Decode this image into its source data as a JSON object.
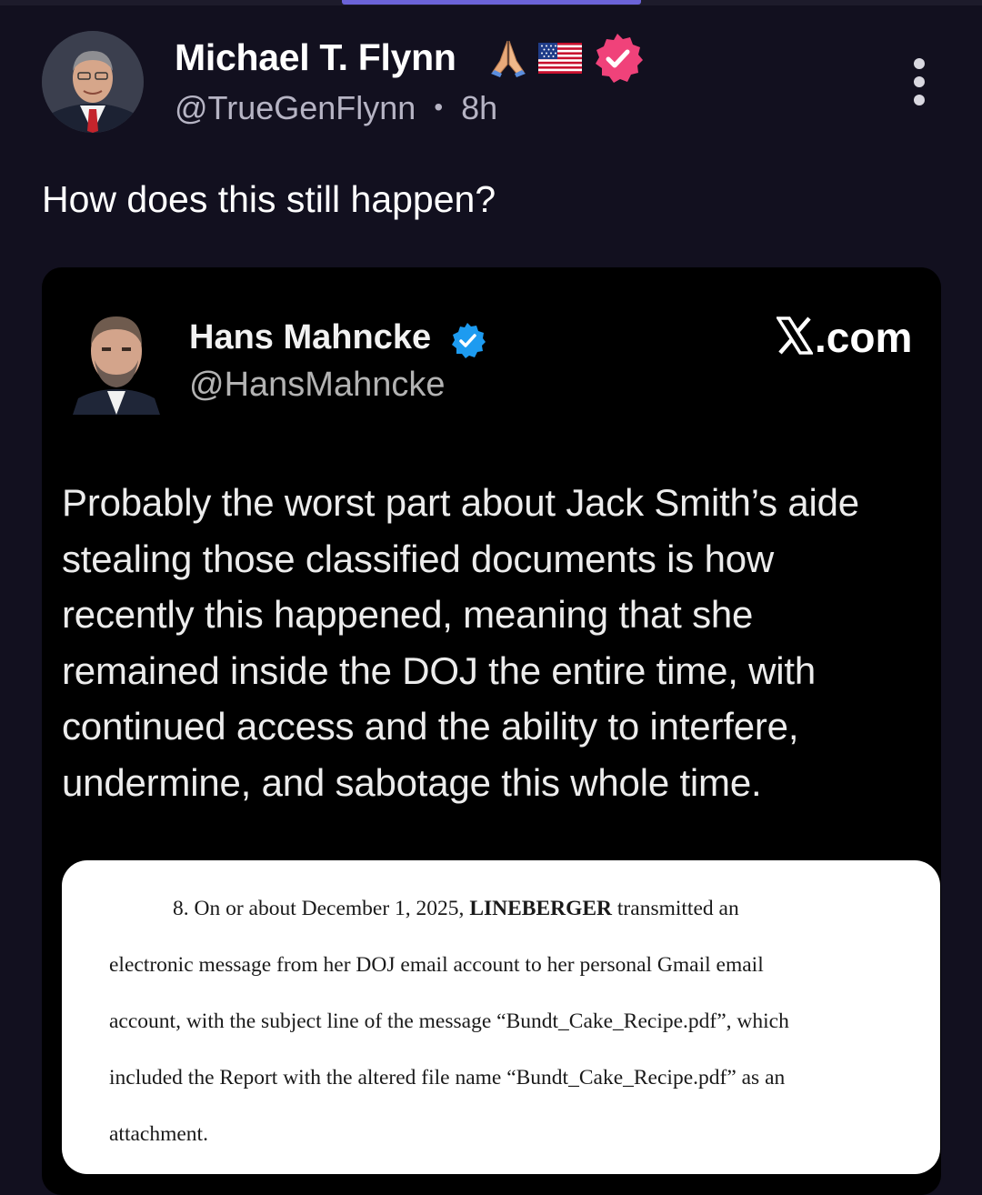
{
  "author": {
    "name": "Michael T. Flynn",
    "handle": "@TrueGenFlynn",
    "separator": "•",
    "time": "8h",
    "badges": [
      "folded-hands-emoji",
      "us-flag-emoji",
      "verified-badge"
    ]
  },
  "post": {
    "text": "How does this still happen?"
  },
  "embed": {
    "name": "Hans Mahncke",
    "handle": "@HansMahncke",
    "source": ".com",
    "body_lines": [
      "Probably the worst part about Jack Smith’s aide",
      "stealing those classified documents is how",
      "recently this happened, meaning that she",
      "remained inside the DOJ the entire time, with",
      "continued access and the ability to interfere,",
      "undermine, and sabotage this whole time."
    ],
    "document": {
      "line1_pre": "8.  On or about December 1, 2025, ",
      "line1_bold": "LINEBERGER",
      "line1_post": " transmitted an",
      "line2": "electronic message from her DOJ email account to her personal Gmail email",
      "line3": "account, with the subject line of the message “Bundt_Cake_Recipe.pdf”, which",
      "line4": "included the Report with the altered file name “Bundt_Cake_Recipe.pdf” as an",
      "line5": "attachment."
    }
  },
  "colors": {
    "background": "#12101f",
    "progress": "#6b63d8",
    "verified_pink": "#f0427a",
    "verified_blue": "#1d9bf0"
  },
  "progress_fraction": 0.305
}
